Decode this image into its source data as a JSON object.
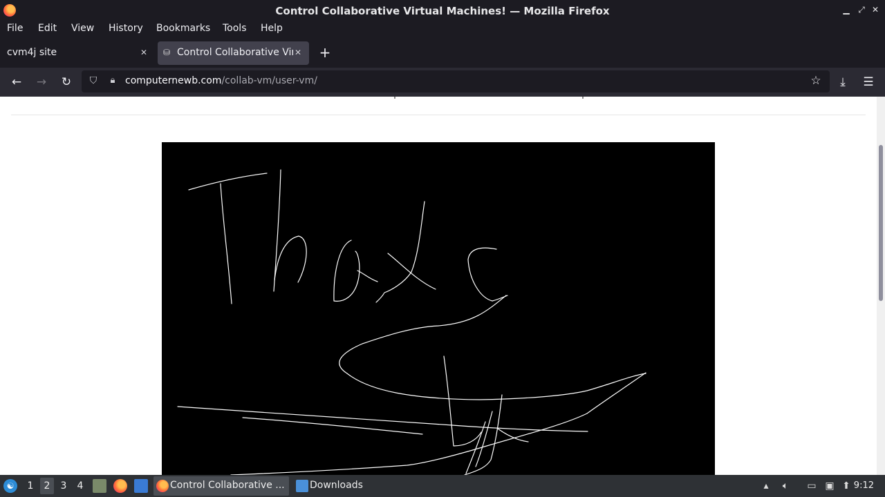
{
  "window": {
    "title": "Control Collaborative Virtual Machines! — Mozilla Firefox"
  },
  "menu": [
    "File",
    "Edit",
    "View",
    "History",
    "Bookmarks",
    "Tools",
    "Help"
  ],
  "tabs": [
    {
      "label": "cvm4j site"
    },
    {
      "label": "Control Collaborative Virtual Machines!"
    }
  ],
  "urlbar": {
    "domain": "computernewb.com",
    "path": "/collab-vm/user-vm/"
  },
  "taskbar": {
    "workspaces": [
      "1",
      "2",
      "3",
      "4"
    ],
    "tasks": [
      {
        "label": "Control Collaborative ..."
      },
      {
        "label": "Downloads"
      }
    ],
    "clock": "9:12"
  },
  "colors": {
    "chrome_dark": "#1c1b22",
    "navbar": "#2b2a33",
    "vm_background": "#000000",
    "stroke": "#ffffff"
  }
}
